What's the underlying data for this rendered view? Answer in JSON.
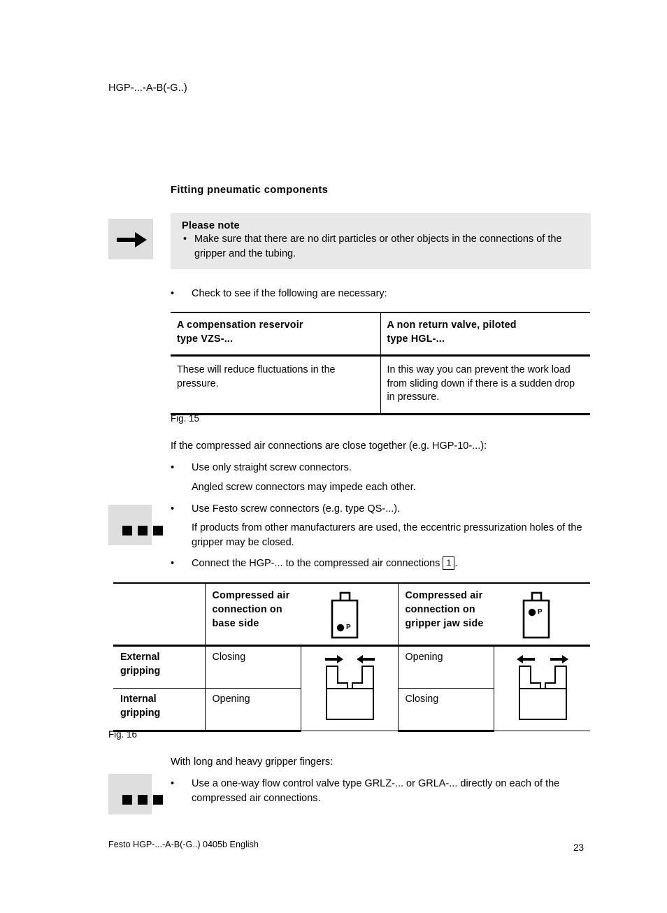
{
  "header": {
    "running_head": "HGP-...-A-B(-G..)"
  },
  "section": {
    "heading": "Fitting pneumatic components"
  },
  "note": {
    "icon": "arrow-right-icon",
    "title": "Please note",
    "bullet": "Make sure that there are no dirt particles or other objects in the connections of the gripper and the tubing."
  },
  "check_bullet": "Check to see if the following are necessary:",
  "table1": {
    "headers": [
      "A compensation reservoir\ntype VZS-...",
      "A non return valve, piloted\ntype HGL-..."
    ],
    "header_left_line1": "A compensation reservoir",
    "header_left_line2": "type VZS-...",
    "header_right_line1": "A non return valve, piloted",
    "header_right_line2": "type HGL-...",
    "cell_left": "These will reduce fluctuations in the pressure.",
    "cell_right": "In this way you can prevent the work load from sliding down if there is a sudden drop in pressure.",
    "caption": "Fig. 15"
  },
  "mid": {
    "intro": "If the compressed air connections are close together (e.g. HGP-10-...):",
    "bullets": [
      {
        "marker": "•",
        "text": "Use only straight screw connectors.",
        "sub": "Angled screw connectors may impede each other."
      },
      {
        "marker": "•",
        "text": "Use Festo screw connectors (e.g. type QS-...).",
        "sub": "If products from other manufacturers are used, the eccentric pressurization holes of the gripper may be closed."
      }
    ],
    "connect_bullet_pre": "Connect the HGP-... to the compressed air connections",
    "connect_ref": "1",
    "connect_bullet_post": "."
  },
  "table2": {
    "col_header_base": "Compressed air connection on base side",
    "col_header_base_lines": [
      "Compressed air",
      "connection on",
      "base side"
    ],
    "col_header_jaw": "Compressed air connection on gripper jaw side",
    "col_header_jaw_lines": [
      "Compressed air",
      "connection on",
      "gripper jaw side"
    ],
    "port_label": "P",
    "rows": [
      {
        "label_line1": "External",
        "label_line2": "gripping",
        "base": "Closing",
        "jaw": "Opening"
      },
      {
        "label_line1": "Internal",
        "label_line2": "gripping",
        "base": "Opening",
        "jaw": "Closing"
      }
    ],
    "diagram_base": {
      "name": "gripper-closing-diagram",
      "arrows": "inward"
    },
    "diagram_jaw": {
      "name": "gripper-opening-diagram",
      "arrows": "outward"
    },
    "caption": "Fig. 16"
  },
  "bottom": {
    "intro": "With long and heavy gripper fingers:",
    "bullet_marker": "•",
    "bullet": "Use a one-way flow control valve type GRLZ-... or GRLA-... directly on each of the compressed air connections."
  },
  "footer": {
    "left": "Festo HGP-...-A-B(-G..) 0405b  English",
    "page": "23"
  }
}
